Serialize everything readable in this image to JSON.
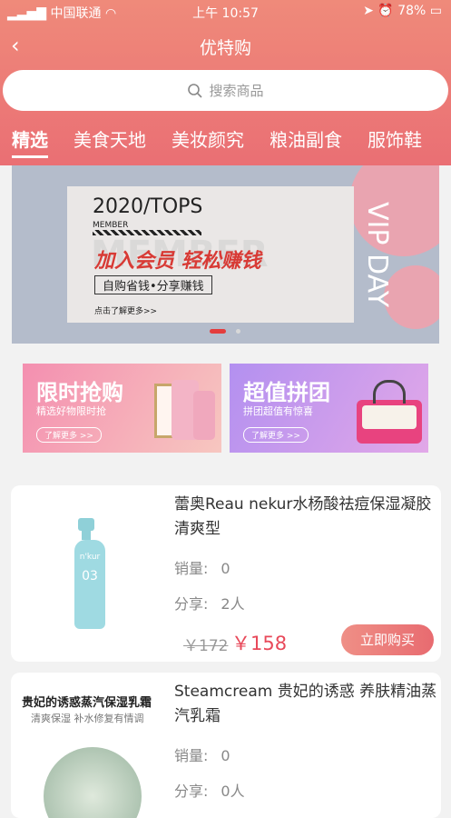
{
  "status": {
    "carrier": "中国联通",
    "time": "上午 10:57",
    "battery": "78%"
  },
  "nav": {
    "title": "优特购"
  },
  "search": {
    "placeholder": "搜索商品"
  },
  "tabs": [
    "精选",
    "美食天地",
    "美妆颜究",
    "粮油副食",
    "服饰鞋"
  ],
  "banner": {
    "year": "2020/TOPS",
    "member": "MEMBER",
    "headline": "加入会员 轻松赚钱",
    "slogan": "自购省钱•分享赚钱",
    "cta": "点击了解更多>>",
    "side": "VIP DAY",
    "bg": "MEMBER"
  },
  "promos": [
    {
      "title": "限时抢购",
      "sub": "精选好物限时抢",
      "more": "了解更多 >>"
    },
    {
      "title": "超值拼团",
      "sub": "拼团超值有惊喜",
      "more": "了解更多 >>"
    }
  ],
  "products": [
    {
      "name": "蕾奥Reau nekur水杨酸祛痘保湿凝胶 清爽型",
      "sales_label": "销量:",
      "sales": "0",
      "share_label": "分享:",
      "share": "2人",
      "old_price": "￥172",
      "price": "￥158",
      "buy": "立即购买",
      "img_brand": "n'kur",
      "img_no": "03"
    },
    {
      "name": "Steamcream 贵妃的诱惑 养肤精油蒸汽乳霜",
      "sales_label": "销量:",
      "sales": "0",
      "share_label": "分享:",
      "share": "0人",
      "img_title": "贵妃的诱惑蒸汽保湿乳霜",
      "img_sub": "清爽保湿 补水修复有情调"
    }
  ],
  "colors": {
    "accent": "#e8495a",
    "header": "#ec7a77"
  }
}
